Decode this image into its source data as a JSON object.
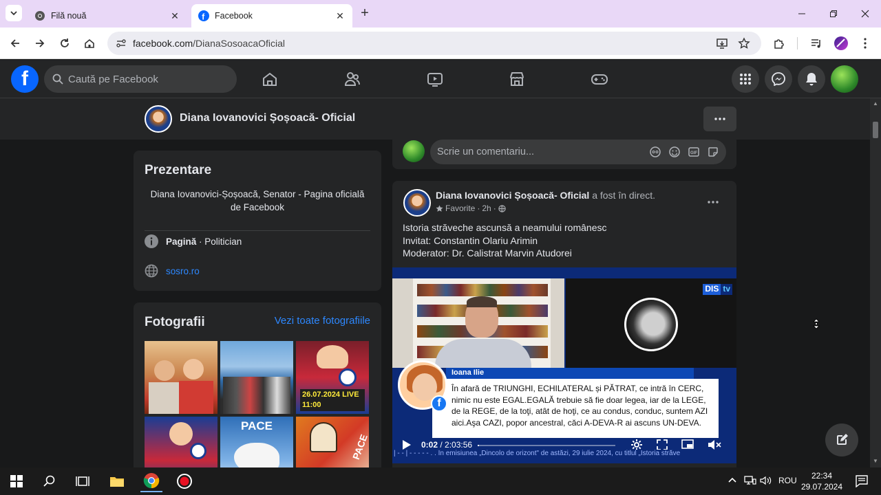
{
  "browser": {
    "tabs": [
      {
        "title": "Filă nouă",
        "active": false
      },
      {
        "title": "Facebook",
        "active": true
      }
    ],
    "url_domain": "facebook.com",
    "url_path": "/DianaSosoacaOficial",
    "accent_color": "#e9d8f7"
  },
  "facebook": {
    "search_placeholder": "Caută pe Facebook",
    "page_name": "Diana Iovanovici Șoșoacă- Oficial",
    "comment_placeholder": "Scrie un comentariu...",
    "intro": {
      "title": "Prezentare",
      "bio": "Diana Iovanovici-Șoșoacă, Senator - Pagina oficială de Facebook",
      "category_label": "Pagină",
      "category_sep": " · ",
      "category_value": "Politician",
      "website": "sosro.ro"
    },
    "photos": {
      "title": "Fotografii",
      "see_all": "Vezi toate fotografiile",
      "tile_captions": [
        "",
        "",
        "26.07.2024 LIVE 11:00",
        "",
        "PACE",
        "PACE"
      ]
    },
    "post": {
      "author": "Diana Iovanovici Șoșoacă- Oficial",
      "action": " a fost în direct.",
      "audience": "Favorite",
      "time": "2h",
      "lines": [
        "Istoria străveche ascunsă a neamului românesc",
        "Invitat: Constantin Olariu Arimin",
        "Moderator: Dr. Calistrat Marvin Atudorei"
      ],
      "video": {
        "channel_a": "DIS",
        "channel_b": "tv",
        "lower_third_name": "Ioana Ilie",
        "lower_third_text": "În afară de TRIUNGHI, ECHILATERAL și PĂTRAT, ce intră în CERC, nimic nu este EGAL.EGALĂ trebuie să fie doar legea, iar de la LEGE, de la REGE, de la toţi, atât de hoţi, ce au condus, conduc, suntem AZI aici.Aşa CAZI, popor ancestral, căci A-DEVA-R ai ascuns UN-DEVA.",
        "ticker": "| - - | - - - - -  . . În emisiunea „Dincolo de orizont\" de astăzi, 29 iulie 2024, cu titlul „Istoria străve",
        "time_current": "0:02",
        "time_total": " / 2:03:56",
        "progress": 0.0003
      }
    }
  },
  "taskbar": {
    "language": "ROU",
    "time": "22:34",
    "date": "29.07.2024"
  }
}
